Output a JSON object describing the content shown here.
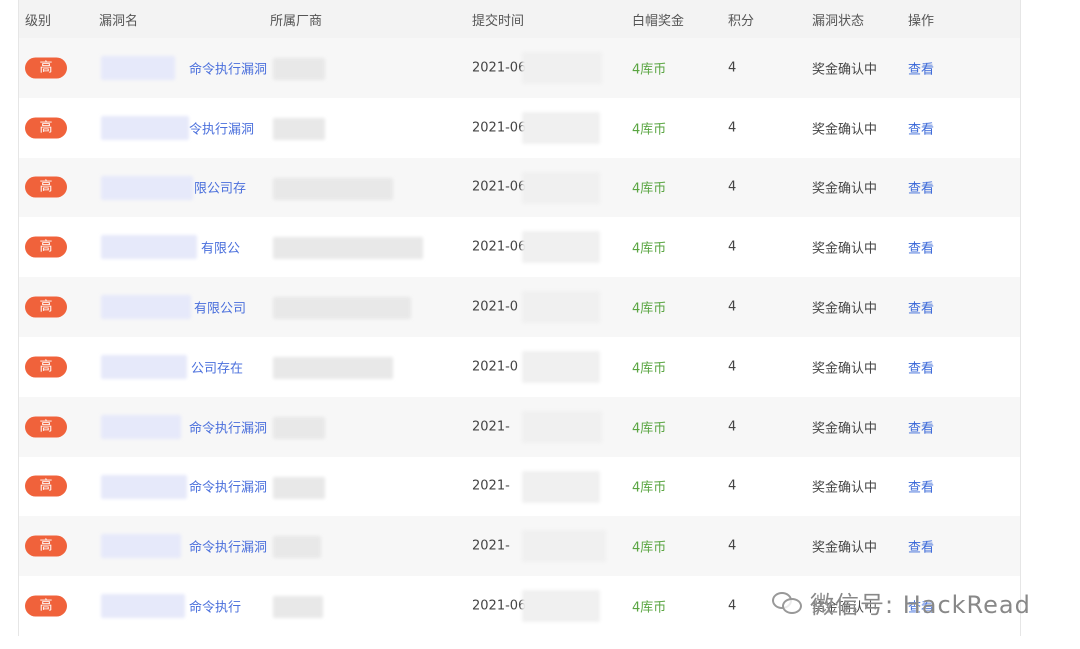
{
  "header": {
    "level": "级别",
    "vuln_name": "漏洞名",
    "vendor": "所属厂商",
    "submit_time": "提交时间",
    "reward": "白帽奖金",
    "points": "积分",
    "status": "漏洞状态",
    "action": "操作"
  },
  "rows": [
    {
      "level": "高",
      "name": "命令执行漏洞",
      "time": "2021-06",
      "reward": "4库币",
      "points": "4",
      "status": "奖金确认中",
      "action": "查看"
    },
    {
      "level": "高",
      "name": "令执行漏洞",
      "time": "2021-06",
      "reward": "4库币",
      "points": "4",
      "status": "奖金确认中",
      "action": "查看"
    },
    {
      "level": "高",
      "name": "限公司存",
      "time": "2021-06",
      "reward": "4库币",
      "points": "4",
      "status": "奖金确认中",
      "action": "查看"
    },
    {
      "level": "高",
      "name": "有限公",
      "time": "2021-06",
      "reward": "4库币",
      "points": "4",
      "status": "奖金确认中",
      "action": "查看"
    },
    {
      "level": "高",
      "name": "有限公司",
      "time": "2021-0",
      "reward": "4库币",
      "points": "4",
      "status": "奖金确认中",
      "action": "查看"
    },
    {
      "level": "高",
      "name": "公司存在",
      "time": "2021-0",
      "reward": "4库币",
      "points": "4",
      "status": "奖金确认中",
      "action": "查看"
    },
    {
      "level": "高",
      "name": "命令执行漏洞",
      "time": "2021-",
      "reward": "4库币",
      "points": "4",
      "status": "奖金确认中",
      "action": "查看"
    },
    {
      "level": "高",
      "name": "命令执行漏洞",
      "time": "2021-",
      "reward": "4库币",
      "points": "4",
      "status": "奖金确认中",
      "action": "查看"
    },
    {
      "level": "高",
      "name": "命令执行漏洞",
      "time": "2021-",
      "reward": "4库币",
      "points": "4",
      "status": "奖金确认中",
      "action": "查看"
    },
    {
      "level": "高",
      "name": "命令执行",
      "time": "2021-06-",
      "reward": "4库币",
      "points": "4",
      "status": "奖金确认中",
      "action": "查看"
    }
  ],
  "watermark": {
    "text": "微信号: HackRead",
    "icon": "wechat-icon"
  },
  "colors": {
    "badge": "#f0623b",
    "link": "#3a68d8",
    "reward": "#5aa542",
    "header_bg": "#f3f3f3"
  }
}
